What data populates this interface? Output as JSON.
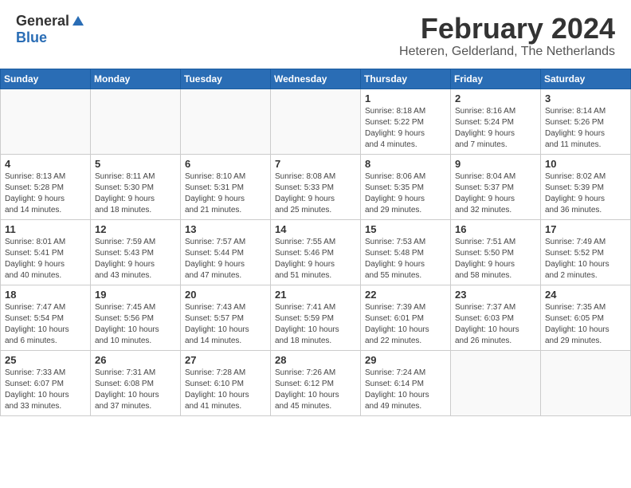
{
  "header": {
    "logo_general": "General",
    "logo_blue": "Blue",
    "title": "February 2024",
    "subtitle": "Heteren, Gelderland, The Netherlands"
  },
  "weekdays": [
    "Sunday",
    "Monday",
    "Tuesday",
    "Wednesday",
    "Thursday",
    "Friday",
    "Saturday"
  ],
  "weeks": [
    [
      {
        "day": "",
        "info": ""
      },
      {
        "day": "",
        "info": ""
      },
      {
        "day": "",
        "info": ""
      },
      {
        "day": "",
        "info": ""
      },
      {
        "day": "1",
        "info": "Sunrise: 8:18 AM\nSunset: 5:22 PM\nDaylight: 9 hours\nand 4 minutes."
      },
      {
        "day": "2",
        "info": "Sunrise: 8:16 AM\nSunset: 5:24 PM\nDaylight: 9 hours\nand 7 minutes."
      },
      {
        "day": "3",
        "info": "Sunrise: 8:14 AM\nSunset: 5:26 PM\nDaylight: 9 hours\nand 11 minutes."
      }
    ],
    [
      {
        "day": "4",
        "info": "Sunrise: 8:13 AM\nSunset: 5:28 PM\nDaylight: 9 hours\nand 14 minutes."
      },
      {
        "day": "5",
        "info": "Sunrise: 8:11 AM\nSunset: 5:30 PM\nDaylight: 9 hours\nand 18 minutes."
      },
      {
        "day": "6",
        "info": "Sunrise: 8:10 AM\nSunset: 5:31 PM\nDaylight: 9 hours\nand 21 minutes."
      },
      {
        "day": "7",
        "info": "Sunrise: 8:08 AM\nSunset: 5:33 PM\nDaylight: 9 hours\nand 25 minutes."
      },
      {
        "day": "8",
        "info": "Sunrise: 8:06 AM\nSunset: 5:35 PM\nDaylight: 9 hours\nand 29 minutes."
      },
      {
        "day": "9",
        "info": "Sunrise: 8:04 AM\nSunset: 5:37 PM\nDaylight: 9 hours\nand 32 minutes."
      },
      {
        "day": "10",
        "info": "Sunrise: 8:02 AM\nSunset: 5:39 PM\nDaylight: 9 hours\nand 36 minutes."
      }
    ],
    [
      {
        "day": "11",
        "info": "Sunrise: 8:01 AM\nSunset: 5:41 PM\nDaylight: 9 hours\nand 40 minutes."
      },
      {
        "day": "12",
        "info": "Sunrise: 7:59 AM\nSunset: 5:43 PM\nDaylight: 9 hours\nand 43 minutes."
      },
      {
        "day": "13",
        "info": "Sunrise: 7:57 AM\nSunset: 5:44 PM\nDaylight: 9 hours\nand 47 minutes."
      },
      {
        "day": "14",
        "info": "Sunrise: 7:55 AM\nSunset: 5:46 PM\nDaylight: 9 hours\nand 51 minutes."
      },
      {
        "day": "15",
        "info": "Sunrise: 7:53 AM\nSunset: 5:48 PM\nDaylight: 9 hours\nand 55 minutes."
      },
      {
        "day": "16",
        "info": "Sunrise: 7:51 AM\nSunset: 5:50 PM\nDaylight: 9 hours\nand 58 minutes."
      },
      {
        "day": "17",
        "info": "Sunrise: 7:49 AM\nSunset: 5:52 PM\nDaylight: 10 hours\nand 2 minutes."
      }
    ],
    [
      {
        "day": "18",
        "info": "Sunrise: 7:47 AM\nSunset: 5:54 PM\nDaylight: 10 hours\nand 6 minutes."
      },
      {
        "day": "19",
        "info": "Sunrise: 7:45 AM\nSunset: 5:56 PM\nDaylight: 10 hours\nand 10 minutes."
      },
      {
        "day": "20",
        "info": "Sunrise: 7:43 AM\nSunset: 5:57 PM\nDaylight: 10 hours\nand 14 minutes."
      },
      {
        "day": "21",
        "info": "Sunrise: 7:41 AM\nSunset: 5:59 PM\nDaylight: 10 hours\nand 18 minutes."
      },
      {
        "day": "22",
        "info": "Sunrise: 7:39 AM\nSunset: 6:01 PM\nDaylight: 10 hours\nand 22 minutes."
      },
      {
        "day": "23",
        "info": "Sunrise: 7:37 AM\nSunset: 6:03 PM\nDaylight: 10 hours\nand 26 minutes."
      },
      {
        "day": "24",
        "info": "Sunrise: 7:35 AM\nSunset: 6:05 PM\nDaylight: 10 hours\nand 29 minutes."
      }
    ],
    [
      {
        "day": "25",
        "info": "Sunrise: 7:33 AM\nSunset: 6:07 PM\nDaylight: 10 hours\nand 33 minutes."
      },
      {
        "day": "26",
        "info": "Sunrise: 7:31 AM\nSunset: 6:08 PM\nDaylight: 10 hours\nand 37 minutes."
      },
      {
        "day": "27",
        "info": "Sunrise: 7:28 AM\nSunset: 6:10 PM\nDaylight: 10 hours\nand 41 minutes."
      },
      {
        "day": "28",
        "info": "Sunrise: 7:26 AM\nSunset: 6:12 PM\nDaylight: 10 hours\nand 45 minutes."
      },
      {
        "day": "29",
        "info": "Sunrise: 7:24 AM\nSunset: 6:14 PM\nDaylight: 10 hours\nand 49 minutes."
      },
      {
        "day": "",
        "info": ""
      },
      {
        "day": "",
        "info": ""
      }
    ]
  ]
}
